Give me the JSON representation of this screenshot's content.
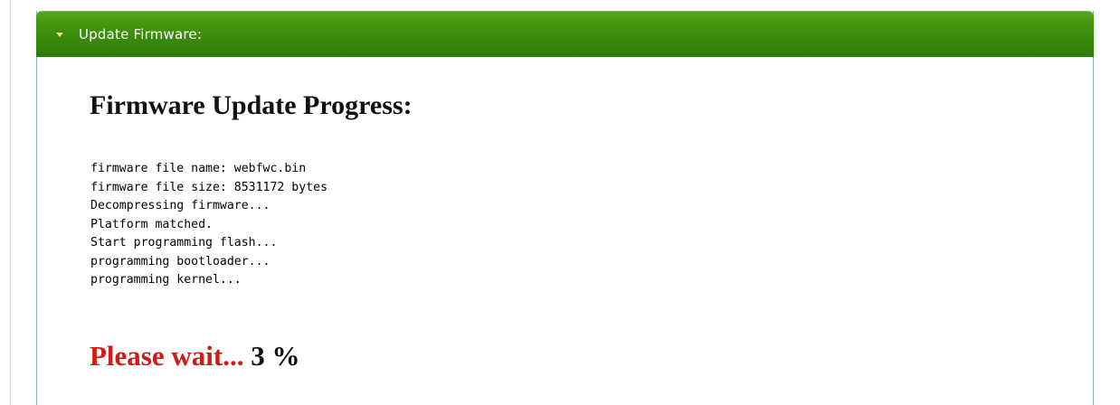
{
  "panel": {
    "header_title": "Update Firmware:",
    "colors": {
      "header_green": "#3f8f0e",
      "caret_yellow": "#f1e25a",
      "panel_border": "#7fb3c9"
    }
  },
  "content": {
    "title": "Firmware Update Progress:",
    "log_lines": [
      "firmware file name: webfwc.bin",
      "firmware file size: 8531172 bytes",
      "Decompressing firmware...",
      "Platform matched.",
      "Start programming flash...",
      "programming bootloader...",
      "programming kernel..."
    ],
    "status": {
      "wait_text": "Please wait...",
      "percent_text": "3 %",
      "progress_percent": 3,
      "wait_color": "#d11a14"
    }
  },
  "icons": {
    "header_caret": "caret-down-icon"
  }
}
